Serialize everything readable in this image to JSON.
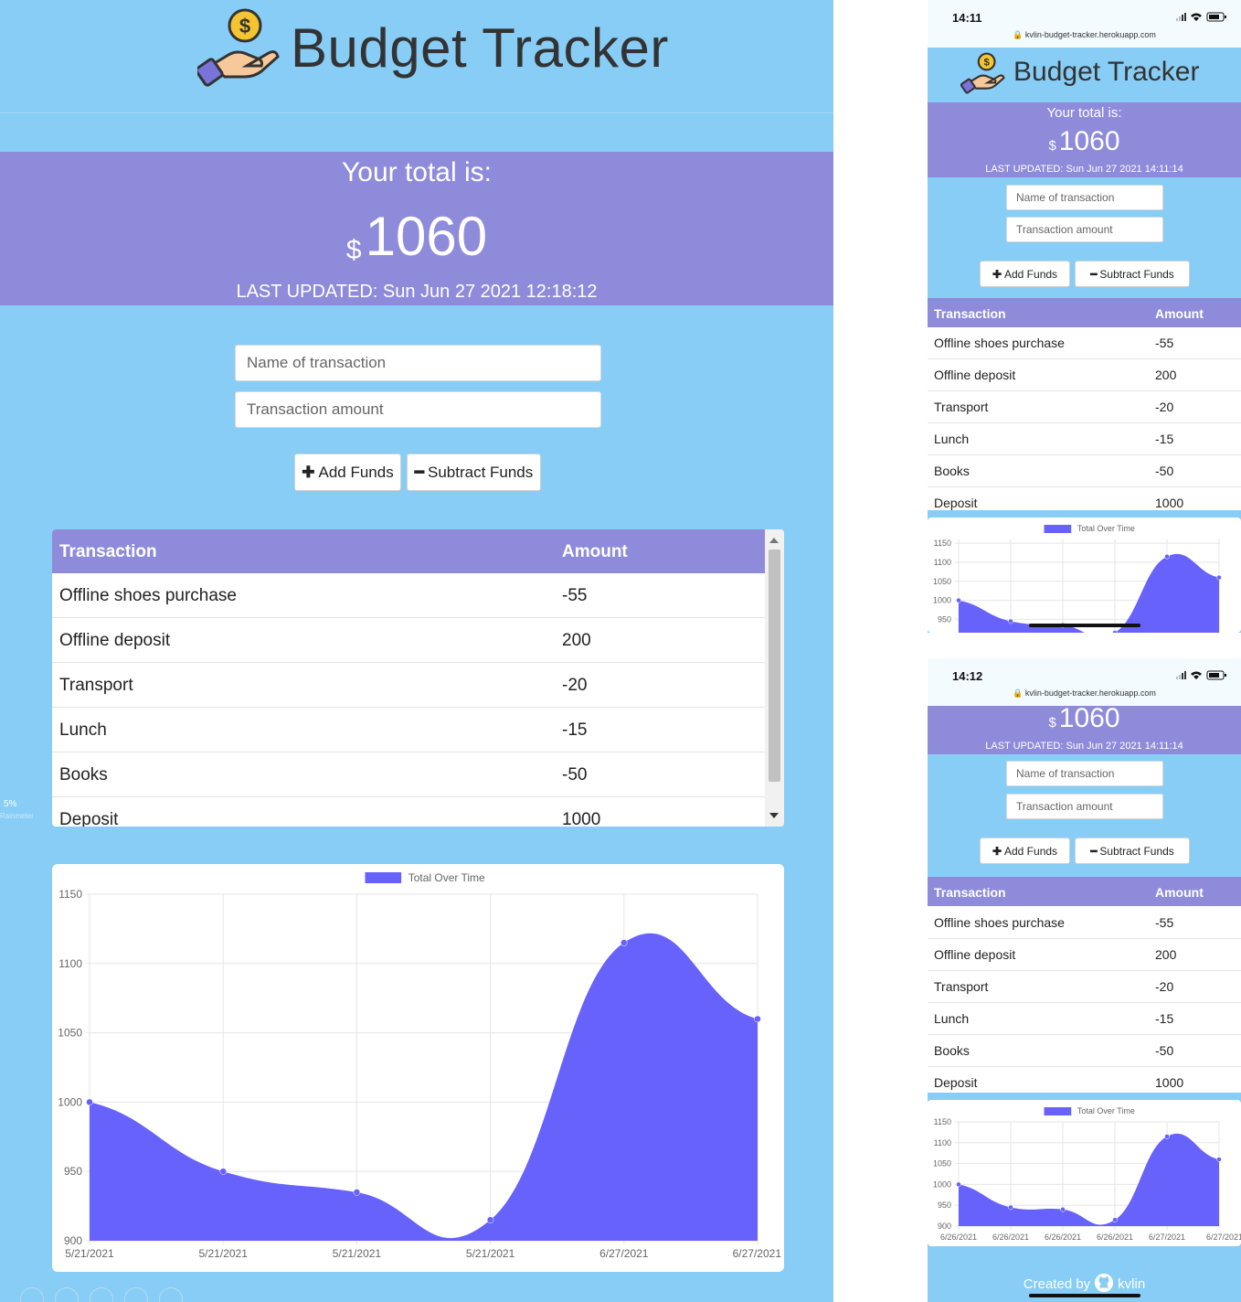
{
  "app": {
    "title": "Budget Tracker",
    "total_label": "Your total is:",
    "currency": "$",
    "total": "1060"
  },
  "desktop": {
    "last_updated": "LAST UPDATED: Sun Jun 27 2021 12:18:12",
    "name_placeholder": "Name of transaction",
    "amount_placeholder": "Transaction amount",
    "add_label": "Add Funds",
    "subtract_label": "Subtract Funds",
    "side_widget_percent": "5%",
    "side_widget_name": "Rainmeter"
  },
  "table": {
    "headers": [
      "Transaction",
      "Amount"
    ],
    "rows": [
      {
        "name": "Offline shoes purchase",
        "amount": "-55"
      },
      {
        "name": "Offline deposit",
        "amount": "200"
      },
      {
        "name": "Transport",
        "amount": "-20"
      },
      {
        "name": "Lunch",
        "amount": "-15"
      },
      {
        "name": "Books",
        "amount": "-50"
      },
      {
        "name": "Deposit",
        "amount": "1000"
      }
    ]
  },
  "phone1": {
    "time": "14:11",
    "url": "kvlin-budget-tracker.herokuapp.com",
    "last_updated": "LAST UPDATED: Sun Jun 27 2021 14:11:14"
  },
  "phone2": {
    "time": "14:12",
    "url": "kvlin-budget-tracker.herokuapp.com",
    "last_updated": "LAST UPDATED: Sun Jun 27 2021 14:11:14",
    "footer_prefix": "Created by",
    "footer_author": "kvlin"
  },
  "colors": {
    "page_bg": "#87cdf5",
    "band": "#8f8bdb",
    "series_fill": "#6762fb"
  },
  "chart_data": [
    {
      "type": "area",
      "legend": "Total Over Time",
      "legend_position": "top",
      "grid": true,
      "x": [
        "5/21/2021",
        "5/21/2021",
        "5/21/2021",
        "5/21/2021",
        "6/27/2021",
        "6/27/2021"
      ],
      "series": [
        {
          "name": "Total Over Time",
          "values": [
            1000,
            950,
            935,
            915,
            1115,
            1060
          ]
        }
      ],
      "y_ticks": [
        900,
        950,
        1000,
        1050,
        1100,
        1150
      ],
      "ylim": [
        900,
        1150
      ]
    },
    {
      "type": "area",
      "legend": "Total Over Time",
      "legend_position": "top",
      "grid": true,
      "x": [],
      "series": [
        {
          "name": "Total Over Time",
          "values": [
            1000,
            945,
            935,
            915,
            1115,
            1060
          ]
        }
      ],
      "y_ticks": [
        950,
        1000,
        1050,
        1100,
        1150
      ],
      "ylim": [
        915,
        1160
      ]
    },
    {
      "type": "area",
      "legend": "Total Over Time",
      "legend_position": "top",
      "grid": true,
      "x": [
        "6/26/2021",
        "6/26/2021",
        "6/26/2021",
        "6/26/2021",
        "6/27/2021",
        "6/27/2021"
      ],
      "series": [
        {
          "name": "Total Over Time",
          "values": [
            1000,
            945,
            940,
            915,
            1115,
            1060
          ]
        }
      ],
      "y_ticks": [
        900,
        950,
        1000,
        1050,
        1100,
        1150
      ],
      "ylim": [
        900,
        1150
      ]
    }
  ]
}
